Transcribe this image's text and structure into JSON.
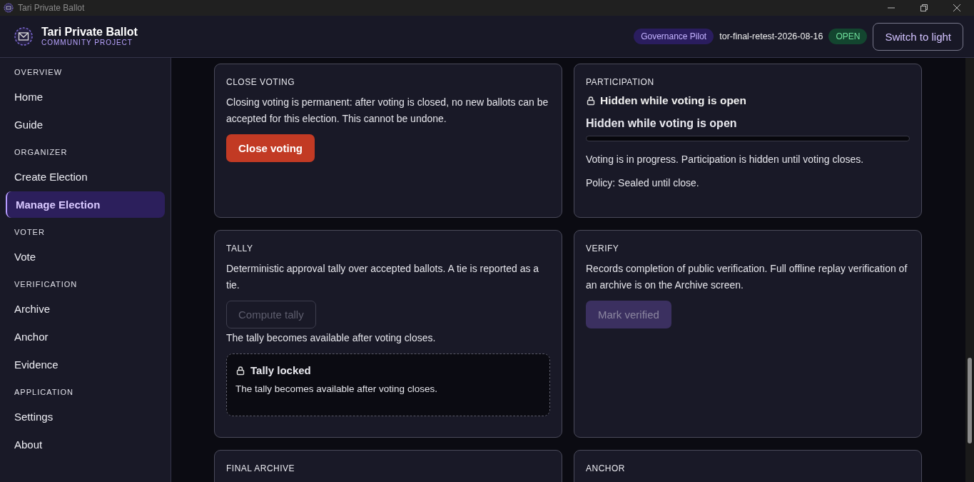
{
  "window": {
    "title": "Tari Private Ballot"
  },
  "header": {
    "app_name": "Tari Private Ballot",
    "subtitle": "COMMUNITY PROJECT",
    "workspace_badge": "Governance Pilot",
    "election_id": "tor-final-retest-2026-08-16",
    "status_badge": "OPEN",
    "theme_button": "Switch to light"
  },
  "sidebar": {
    "sections": [
      {
        "heading": "OVERVIEW",
        "items": [
          {
            "label": "Home",
            "selected": false
          },
          {
            "label": "Guide",
            "selected": false
          }
        ]
      },
      {
        "heading": "ORGANIZER",
        "items": [
          {
            "label": "Create Election",
            "selected": false
          },
          {
            "label": "Manage Election",
            "selected": true
          }
        ]
      },
      {
        "heading": "VOTER",
        "items": [
          {
            "label": "Vote",
            "selected": false
          }
        ]
      },
      {
        "heading": "VERIFICATION",
        "items": [
          {
            "label": "Archive",
            "selected": false
          },
          {
            "label": "Anchor",
            "selected": false
          },
          {
            "label": "Evidence",
            "selected": false
          }
        ]
      },
      {
        "heading": "APPLICATION",
        "items": [
          {
            "label": "Settings",
            "selected": false
          },
          {
            "label": "About",
            "selected": false
          }
        ]
      }
    ]
  },
  "cards": [
    {
      "heading": "CLOSE VOTING",
      "blocks": [
        {
          "kind": "text",
          "text": "Closing voting is permanent: after voting is closed, no new ballots can be accepted for this election. This cannot be undone."
        },
        {
          "kind": "danger_button",
          "label": "Close voting",
          "disabled": false
        }
      ]
    },
    {
      "heading": "PARTICIPATION",
      "blocks": [
        {
          "kind": "lock_line",
          "text": "Hidden while voting is open"
        },
        {
          "kind": "meter",
          "title": "Hidden while voting is open",
          "level": 0
        },
        {
          "kind": "text",
          "text": "Voting is in progress. Participation is hidden until voting closes."
        },
        {
          "kind": "text",
          "text": "Policy: Sealed until close."
        }
      ]
    },
    {
      "heading": "TALLY",
      "blocks": [
        {
          "kind": "text",
          "text": "Deterministic approval tally over accepted ballots. A tie is reported as a tie."
        },
        {
          "kind": "outline_button",
          "label": "Compute tally",
          "disabled": true
        },
        {
          "kind": "note",
          "text": "The tally becomes available after voting closes."
        },
        {
          "kind": "locked_box",
          "title": "Tally locked",
          "text": "The tally becomes available after voting closes."
        }
      ]
    },
    {
      "heading": "VERIFY",
      "blocks": [
        {
          "kind": "text",
          "text": "Records completion of public verification. Full offline replay verification of an archive is on the Archive screen."
        },
        {
          "kind": "primary_button",
          "label": "Mark verified",
          "disabled": true
        }
      ]
    },
    {
      "heading": "FINAL ARCHIVE"
    },
    {
      "heading": "ANCHOR"
    }
  ]
}
